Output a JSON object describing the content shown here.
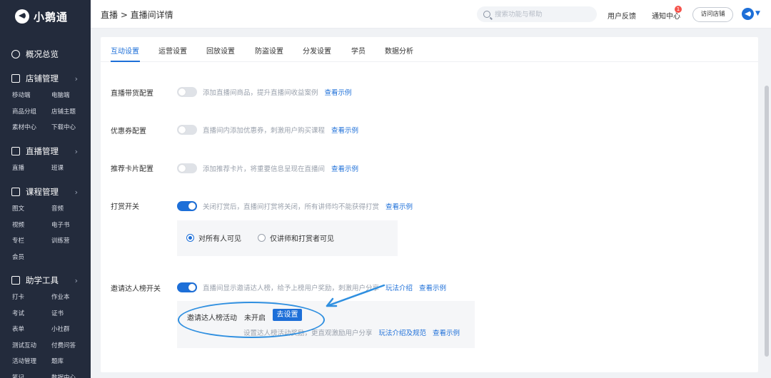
{
  "app": {
    "name": "小鹅通"
  },
  "sidebar": {
    "overview": "概况总览",
    "groups": [
      {
        "title": "店铺管理",
        "items": [
          "移动端",
          "电脑端",
          "商品分组",
          "店铺主题",
          "素材中心",
          "下载中心"
        ]
      },
      {
        "title": "直播管理",
        "items": [
          "直播",
          "班课"
        ]
      },
      {
        "title": "课程管理",
        "items": [
          "图文",
          "音频",
          "视频",
          "电子书",
          "专栏",
          "训练营",
          "会员"
        ]
      },
      {
        "title": "助学工具",
        "items": [
          "打卡",
          "作业本",
          "考试",
          "证书",
          "表单",
          "小社群",
          "测试互动",
          "付费问答",
          "活动管理",
          "题库",
          "笔记",
          "数据中心"
        ]
      }
    ]
  },
  "header": {
    "breadcrumb": "直播 > 直播间详情",
    "search_placeholder": "搜索功能与帮助",
    "feedback": "用户反馈",
    "notice": "通知中心",
    "notice_count": "1",
    "visit_store": "访问店铺"
  },
  "tabs": [
    "互动设置",
    "运营设置",
    "回放设置",
    "防盗设置",
    "分发设置",
    "学员",
    "数据分析"
  ],
  "settings": {
    "goods": {
      "label": "直播带货配置",
      "desc": "添加直播间商品，提升直播间收益案例",
      "link": "查看示例",
      "on": false
    },
    "coupon": {
      "label": "优惠券配置",
      "desc": "直播间内添加优惠券，刺激用户购买课程",
      "link": "查看示例",
      "on": false
    },
    "card": {
      "label": "推荐卡片配置",
      "desc": "添加推荐卡片，将重要信息呈现在直播间",
      "link": "查看示例",
      "on": false
    },
    "reward": {
      "label": "打赏开关",
      "desc": "关闭打赏后，直播间打赏将关闭，所有讲师均不能获得打赏",
      "link": "查看示例",
      "on": true,
      "options": [
        "对所有人可见",
        "仅讲师和打赏者可见"
      ],
      "selected": 0
    },
    "invite": {
      "label": "邀请达人榜开关",
      "desc": "直播间显示邀请达人榜，给予上榜用户奖励，刺激用户分享",
      "link1": "玩法介绍",
      "link2": "查看示例",
      "on": true,
      "activity_label": "邀请达人榜活动",
      "status": "未开启",
      "button": "去设置",
      "activity_desc": "设置达人榜活动奖励，更直观激励用户分享",
      "activity_link1": "玩法介绍及规范",
      "activity_link2": "查看示例"
    }
  },
  "colors": {
    "primary": "#1d6fd8",
    "sidebar": "#232b3c",
    "annotation": "#2f8fe0",
    "badge": "#f5534c"
  }
}
